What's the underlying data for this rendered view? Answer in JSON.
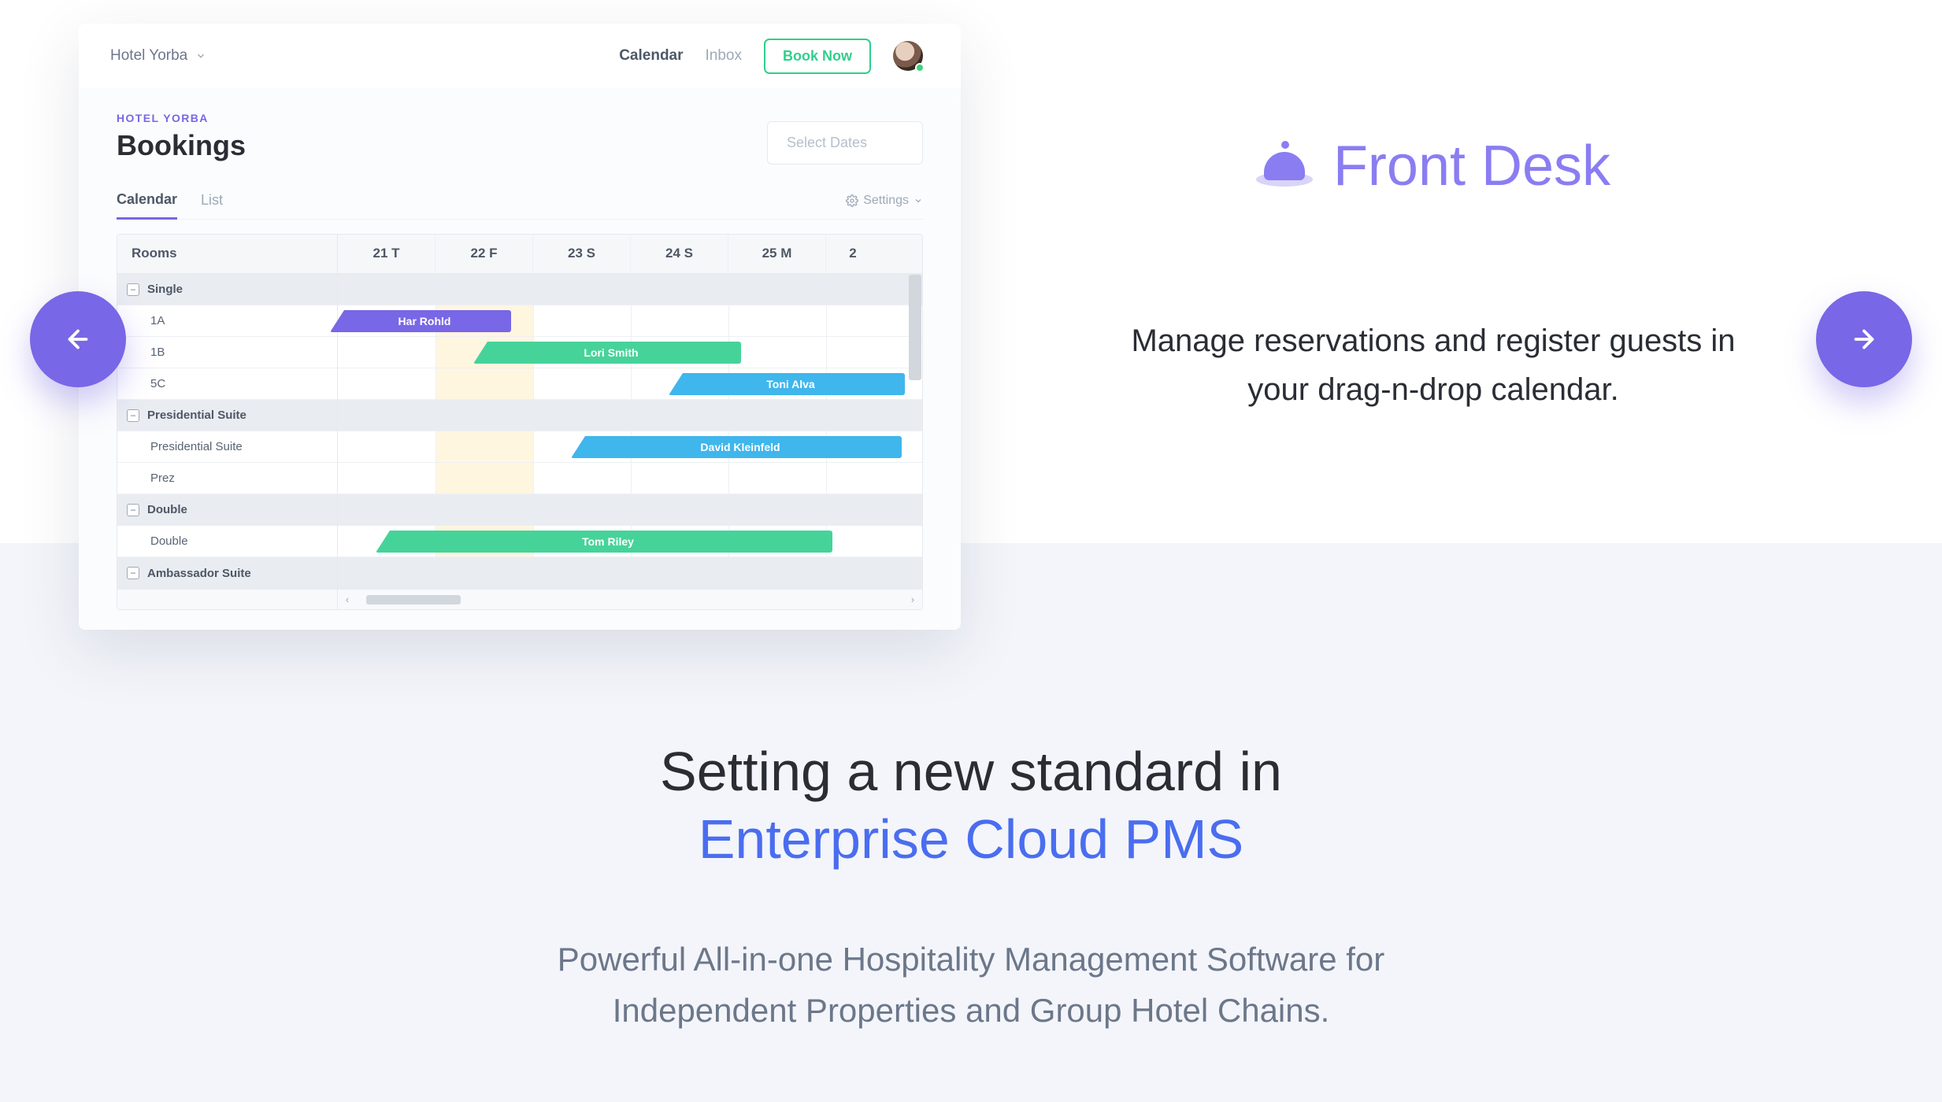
{
  "topbar": {
    "hotel_name": "Hotel Yorba",
    "nav_calendar": "Calendar",
    "nav_inbox": "Inbox",
    "book_now": "Book Now"
  },
  "header": {
    "breadcrumb": "HOTEL YORBA",
    "title": "Bookings",
    "date_placeholder": "Select Dates"
  },
  "tabs": {
    "calendar": "Calendar",
    "list": "List",
    "settings": "Settings"
  },
  "grid": {
    "rooms_label": "Rooms",
    "days": [
      "21 T",
      "22 F",
      "23 S",
      "24 S",
      "25 M",
      "2"
    ],
    "groups": [
      {
        "name": "Single",
        "rooms": [
          "1A",
          "1B",
          "5C"
        ]
      },
      {
        "name": "Presidential Suite",
        "rooms": [
          "Presidential Suite",
          "Prez"
        ]
      },
      {
        "name": "Double",
        "rooms": [
          "Double"
        ]
      },
      {
        "name": "Ambassador Suite",
        "rooms": []
      }
    ],
    "bookings": {
      "b1": "Har Rohld",
      "b2": "Lori Smith",
      "b3": "Toni Alva",
      "b4": "David Kleinfeld",
      "b5": "Tom Riley"
    }
  },
  "feature": {
    "title": "Front Desk",
    "desc_line1": "Manage reservations and register guests in",
    "desc_line2": "your drag-n-drop calendar."
  },
  "lower": {
    "line1": "Setting a new standard in",
    "line2": "Enterprise Cloud PMS",
    "sub1": "Powerful All-in-one Hospitality Management Software for",
    "sub2": "Independent Properties and Group Hotel Chains."
  }
}
